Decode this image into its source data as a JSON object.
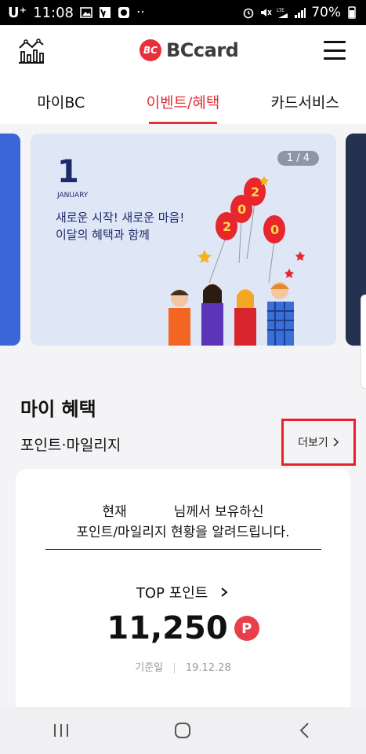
{
  "status_bar": {
    "carrier": "U⁺",
    "time": "11:08",
    "dots": "··",
    "battery": "70%"
  },
  "header": {
    "logo_text": "BCcard",
    "logo_mark": "BC"
  },
  "tabs": [
    {
      "label": "마이BC",
      "active": false
    },
    {
      "label": "이벤트/혜택",
      "active": true
    },
    {
      "label": "카드서비스",
      "active": false
    }
  ],
  "banner": {
    "counter": "1 / 4",
    "month_number": "1",
    "month_name": "JANUARY",
    "line1": "새로운 시작! 새로운 마음!",
    "line2": "이달의 혜택과 함께",
    "balloon_digits": [
      "2",
      "0",
      "2",
      "0"
    ]
  },
  "section": {
    "title": "마이 혜택",
    "subtitle": "포인트·마일리지",
    "more_label": "더보기"
  },
  "card": {
    "message_prefix": "현재",
    "message_suffix": "님께서 보유하신",
    "message_line2": "포인트/마일리지 현황을 알려드립니다.",
    "top_point_label": "TOP 포인트",
    "points_value": "11,250",
    "points_badge": "P",
    "base_label": "기준일",
    "base_date": "19.12.28"
  },
  "colors": {
    "brand_red": "#e0303a",
    "highlight": "#e8202a"
  }
}
